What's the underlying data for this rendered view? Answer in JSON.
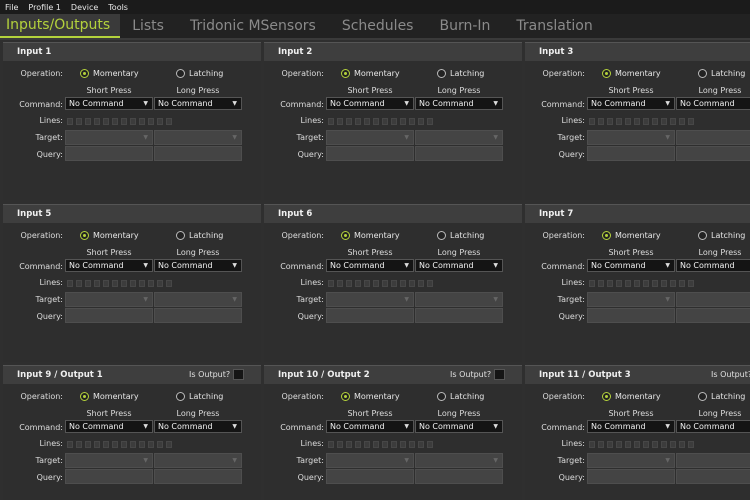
{
  "menu": [
    "File",
    "Profile 1",
    "Device",
    "Tools"
  ],
  "tabs": [
    "Inputs/Outputs",
    "Lists",
    "Tridonic MSensors",
    "Schedules",
    "Burn-In",
    "Translation"
  ],
  "active_tab": "Inputs/Outputs",
  "accent_color": "#b4d23c",
  "labels": {
    "operation": "Operation:",
    "momentary": "Momentary",
    "latching": "Latching",
    "short_press": "Short Press",
    "long_press": "Long Press",
    "command": "Command:",
    "lines": "Lines:",
    "target": "Target:",
    "query": "Query:",
    "is_output": "Is Output?"
  },
  "panels": [
    {
      "title": "Input 1",
      "operation": "Momentary",
      "short_press_command": "No Command",
      "long_press_command": "No Command"
    },
    {
      "title": "Input 2",
      "operation": "Momentary",
      "short_press_command": "No Command",
      "long_press_command": "No Command"
    },
    {
      "title": "Input 3",
      "operation": "Momentary",
      "short_press_command": "No Command",
      "long_press_command": "No Command"
    },
    {
      "title": "Input 5",
      "operation": "Momentary",
      "short_press_command": "No Command",
      "long_press_command": "No Command"
    },
    {
      "title": "Input 6",
      "operation": "Momentary",
      "short_press_command": "No Command",
      "long_press_command": "No Command"
    },
    {
      "title": "Input 7",
      "operation": "Momentary",
      "short_press_command": "No Command",
      "long_press_command": "No Command"
    },
    {
      "title": "Input 9 / Output 1",
      "operation": "Momentary",
      "short_press_command": "No Command",
      "long_press_command": "No Command",
      "is_output": false
    },
    {
      "title": "Input 10 / Output 2",
      "operation": "Momentary",
      "short_press_command": "No Command",
      "long_press_command": "No Command",
      "is_output": false
    },
    {
      "title": "Input 11 / Output 3",
      "operation": "Momentary",
      "short_press_command": "No Command",
      "long_press_command": "No Command",
      "is_output": false
    }
  ]
}
